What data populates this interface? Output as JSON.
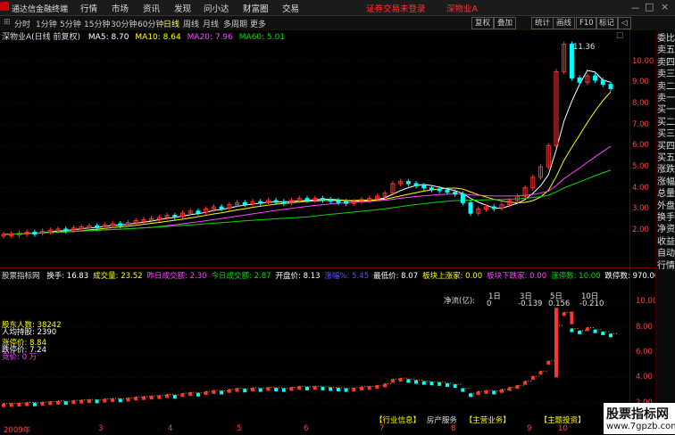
{
  "app": {
    "title": "通达信金融终端"
  },
  "menu": [
    "行情",
    "市场",
    "资讯",
    "发现",
    "问小达",
    "财富圈",
    "交易"
  ],
  "notice": "证券交易未登录",
  "stock_name_top": "深物业A",
  "window_controls": [
    "－",
    "□",
    "×"
  ],
  "periods": [
    "分时",
    "1分钟",
    "5分钟",
    "15分钟",
    "30分钟",
    "60分钟",
    "日线",
    "周线",
    "月线",
    "多周期",
    "更多"
  ],
  "selected_period": "日线",
  "tools": [
    "复权",
    "叠加",
    "画线",
    "统计",
    "F10",
    "标记",
    "◁"
  ],
  "chart_title": "深物业A(日线 前复权)",
  "ma": [
    {
      "label": "MA5: 8.70",
      "color": "#ffffff"
    },
    {
      "label": "MA10: 8.64",
      "color": "#ffff00"
    },
    {
      "label": "MA20: 7.96",
      "color": "#ff44ff"
    },
    {
      "label": "MA60: 5.01",
      "color": "#00dd00"
    }
  ],
  "y_ticks": [
    "10.00",
    "9.00",
    "8.00",
    "7.00",
    "6.00",
    "5.00",
    "4.00",
    "3.00",
    "2.00"
  ],
  "high_label": "11.36",
  "right_panel": [
    "委比",
    "卖五",
    "卖四",
    "卖三",
    "卖二",
    "卖一",
    "买一",
    "买二",
    "买三",
    "买四",
    "买五",
    "涨跌",
    "涨幅",
    "总量",
    "外盘",
    "换手",
    "净资",
    "收益",
    "自动",
    "行情"
  ],
  "indicator_name": "股票指标网",
  "indicator_items": [
    {
      "t": "换手: 16.83",
      "c": "#ffffff"
    },
    {
      "t": "成交量: 23.52",
      "c": "#ffff00"
    },
    {
      "t": "昨日成交额: 2.30",
      "c": "#ff44ff"
    },
    {
      "t": "今日成交额: 2.87",
      "c": "#00dd00"
    },
    {
      "t": "开盘价: 8.13",
      "c": "#ffffff"
    },
    {
      "t": "涨幅%: 5.45",
      "c": "#5555ff"
    },
    {
      "t": "最低价: 8.07",
      "c": "#ffffff"
    },
    {
      "t": "板块上涨家: 0.00",
      "c": "#ffff00"
    },
    {
      "t": "板块下跌家: 0.00",
      "c": "#ff44ff"
    },
    {
      "t": "涨停数: 10.00",
      "c": "#00dd00"
    },
    {
      "t": "跌停数: 970.00",
      "c": "#ffffff"
    }
  ],
  "sub_labels": [
    {
      "t": "股东人数: 38242",
      "c": "#ffff00"
    },
    {
      "t": "人均持股: 2390",
      "c": "#ffffff"
    },
    {
      "t": "涨停价: 8.84",
      "c": "#ffff00"
    },
    {
      "t": "跌停价: 7.24",
      "c": "#ffffff"
    },
    {
      "t": "竞价: 0 万",
      "c": "#ff44ff"
    }
  ],
  "netflow": {
    "label": "净流(亿):",
    "days": [
      "1日",
      "3日",
      "5日",
      "10日"
    ],
    "values": [
      "0",
      "-0.139",
      "0.156",
      "-0.210"
    ]
  },
  "sub_y_ticks": [
    "10.00",
    "8.00",
    "6.00",
    "4.00",
    "2.00"
  ],
  "x_labels": [
    "2009年",
    "3",
    "4",
    "5",
    "6",
    "7",
    "8",
    "9",
    "10"
  ],
  "bottom_info": [
    "【行业信息】",
    "房产服务",
    "【主营业务】",
    "【主题投资】"
  ],
  "watermark": {
    "line1": "股票指标网",
    "line2": "www.7gpzb.com"
  },
  "price_series": [
    1.8,
    1.82,
    1.85,
    1.9,
    1.88,
    1.95,
    2.0,
    2.05,
    2.02,
    2.1,
    2.15,
    2.2,
    2.18,
    2.25,
    2.3,
    2.28,
    2.35,
    2.45,
    2.5,
    2.55,
    2.6,
    2.7,
    2.65,
    2.8,
    2.9,
    2.85,
    3.0,
    3.1,
    3.05,
    3.2,
    3.3,
    3.25,
    3.35,
    3.3,
    3.4,
    3.35,
    3.3,
    3.4,
    3.5,
    3.45,
    3.5,
    3.45,
    3.4,
    3.35,
    3.3,
    3.35,
    3.45,
    3.5,
    3.6,
    3.75,
    4.2,
    4.3,
    4.2,
    4.1,
    4.0,
    3.95,
    3.9,
    3.8,
    3.7,
    3.3,
    2.8,
    3.0,
    3.1,
    3.05,
    3.2,
    3.4,
    3.6,
    4.0,
    4.5,
    5.0,
    6.0,
    9.5,
    10.8,
    9.2,
    9.0,
    9.3,
    9.1,
    8.9,
    8.7
  ]
}
